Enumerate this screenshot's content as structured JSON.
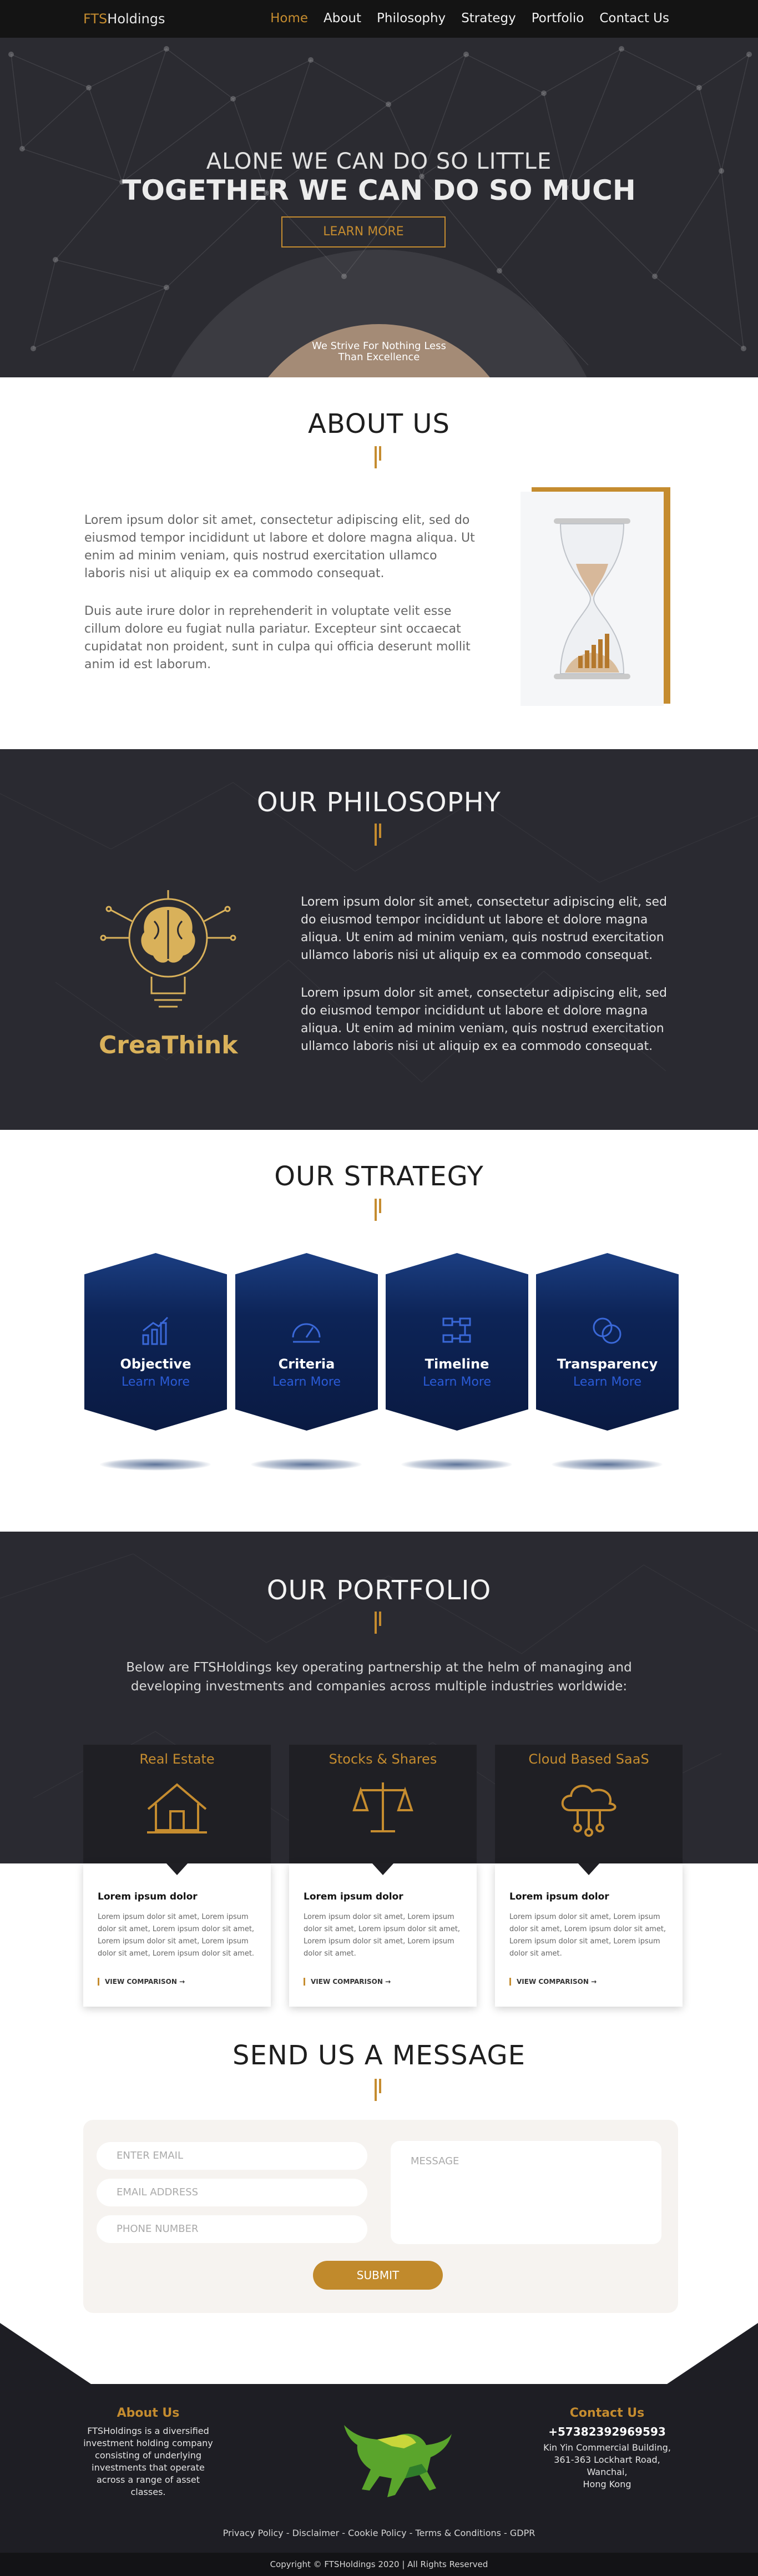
{
  "nav": {
    "logo_accent": "FTS",
    "logo_rest": "Holdings",
    "items": [
      {
        "label": "Home"
      },
      {
        "label": "About"
      },
      {
        "label": "Philosophy"
      },
      {
        "label": "Strategy"
      },
      {
        "label": "Portfolio"
      },
      {
        "label": "Contact Us"
      }
    ]
  },
  "hero": {
    "subtitle": "ALONE WE CAN DO SO LITTLE",
    "title": "TOGETHER WE CAN DO SO MUCH",
    "button": "LEARN MORE",
    "tagline_line1": "We Strive For Nothing Less",
    "tagline_line2": "Than Excellence"
  },
  "about": {
    "title": "ABOUT US",
    "paragraphs": [
      "Lorem ipsum dolor sit amet, consectetur adipiscing elit, sed do eiusmod tempor incididunt ut labore et dolore magna aliqua. Ut enim ad minim veniam, quis nostrud exercitation ullamco laboris nisi ut aliquip ex ea commodo consequat.",
      "Duis aute irure dolor in reprehenderit in voluptate velit esse cillum dolore eu fugiat nulla pariatur. Excepteur sint occaecat cupidatat non proident, sunt in culpa qui officia deserunt mollit anim id est laborum."
    ]
  },
  "philosophy": {
    "title": "OUR PHILOSOPHY",
    "brand": "CreaThink",
    "paragraphs": [
      "Lorem ipsum dolor sit amet, consectetur adipiscing elit, sed do eiusmod tempor incididunt ut labore et dolore magna aliqua. Ut enim ad minim veniam, quis nostrud exercitation ullamco laboris nisi ut aliquip ex ea commodo consequat.",
      "Lorem ipsum dolor sit amet, consectetur adipiscing elit, sed do eiusmod tempor incididunt ut labore et dolore magna aliqua. Ut enim ad minim veniam, quis nostrud exercitation ullamco laboris nisi ut aliquip ex ea commodo consequat."
    ]
  },
  "strategy": {
    "title": "OUR STRATEGY",
    "cards": [
      {
        "label": "Objective",
        "link": "Learn More",
        "icon": "bar-chart-icon"
      },
      {
        "label": "Criteria",
        "link": "Learn More",
        "icon": "gauge-icon"
      },
      {
        "label": "Timeline",
        "link": "Learn More",
        "icon": "timeline-icon"
      },
      {
        "label": "Transparency",
        "link": "Learn More",
        "icon": "circles-icon"
      }
    ]
  },
  "portfolio": {
    "title": "OUR PORTFOLIO",
    "intro": "Below are FTSHoldings key operating partnership at the helm of managing and developing investments and companies across multiple industries worldwide:",
    "cards": [
      {
        "category": "Real Estate",
        "icon": "house-icon",
        "heading": "Lorem ipsum dolor",
        "body": "Lorem ipsum dolor sit amet, Lorem ipsum dolor sit amet, Lorem ipsum dolor sit amet, Lorem ipsum dolor sit amet, Lorem ipsum dolor sit amet, Lorem ipsum dolor sit amet.",
        "cta": "VIEW COMPARISON →"
      },
      {
        "category": "Stocks & Shares",
        "icon": "scales-icon",
        "heading": "Lorem ipsum dolor",
        "body": "Lorem ipsum dolor sit amet, Lorem ipsum dolor sit amet, Lorem ipsum dolor sit amet, Lorem ipsum dolor sit amet, Lorem ipsum dolor sit amet.",
        "cta": "VIEW COMPARISON →"
      },
      {
        "category": "Cloud Based SaaS",
        "icon": "cloud-network-icon",
        "heading": "Lorem ipsum dolor",
        "body": "Lorem ipsum dolor sit amet, Lorem ipsum dolor sit amet, Lorem ipsum dolor sit amet, Lorem ipsum dolor sit amet, Lorem ipsum dolor sit amet.",
        "cta": "VIEW COMPARISON →"
      }
    ]
  },
  "contact_form": {
    "title": "SEND US A MESSAGE",
    "email_placeholder": "ENTER EMAIL",
    "address_placeholder": "EMAIL ADDRESS",
    "phone_placeholder": "PHONE NUMBER",
    "message_placeholder": "MESSAGE",
    "submit": "SUBMIT"
  },
  "footer": {
    "about_title": "About Us",
    "about_text": "FTSHoldings is a diversified investment holding company consisting of underlying investments that operate across a range of asset classes.",
    "contact_title": "Contact Us",
    "phone": "+57382392969593",
    "address_lines": [
      "Kin Yin Commercial Building,",
      "361-363 Lockhart Road,",
      "Wanchai,",
      "Hong Kong"
    ],
    "links": "Privacy Policy - Disclaimer - Cookie Policy - Terms & Conditions - GDPR",
    "copyright": "Copyright © FTSHoldings 2020 | All Rights Reserved"
  },
  "colors": {
    "accent": "#c58c2f",
    "dark_bg": "#2a2a31",
    "nav_bg": "#141414",
    "hex_blue": "#0d2457"
  }
}
